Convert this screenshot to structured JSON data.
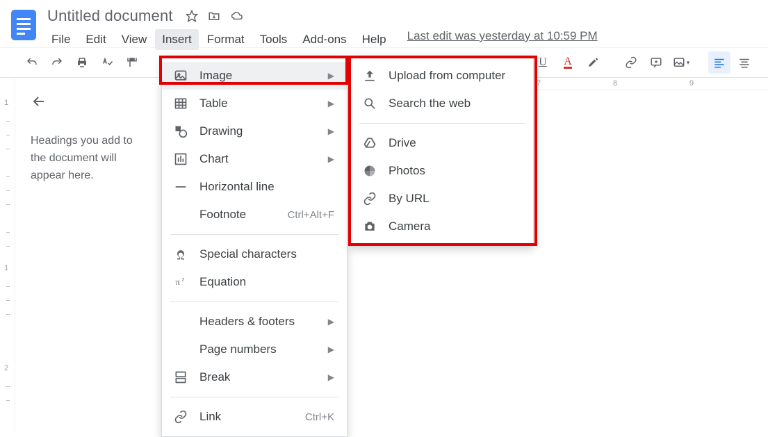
{
  "header": {
    "doc_title": "Untitled document",
    "last_edit": "Last edit was yesterday at 10:59 PM"
  },
  "menubar": [
    "File",
    "Edit",
    "View",
    "Insert",
    "Format",
    "Tools",
    "Add-ons",
    "Help"
  ],
  "active_menu_index": 3,
  "outline": {
    "hint": "Headings you add to the document will appear here."
  },
  "hruler_marks": [
    "7",
    "8",
    "9"
  ],
  "vruler_marks": [
    "1",
    "1",
    "2"
  ],
  "insert_menu": [
    {
      "icon": "image-icon",
      "label": "Image",
      "submenu": true,
      "highlight": true
    },
    {
      "icon": "table-icon",
      "label": "Table",
      "submenu": true
    },
    {
      "icon": "drawing-icon",
      "label": "Drawing",
      "submenu": true
    },
    {
      "icon": "chart-icon",
      "label": "Chart",
      "submenu": true
    },
    {
      "icon": "hr-icon",
      "label": "Horizontal line"
    },
    {
      "icon": "footnote-icon",
      "label": "Footnote",
      "shortcut": "Ctrl+Alt+F",
      "noicon": true
    },
    {
      "sep": true
    },
    {
      "icon": "omega-icon",
      "label": "Special characters"
    },
    {
      "icon": "pi-icon",
      "label": "Equation"
    },
    {
      "sep": true
    },
    {
      "icon": "header-icon",
      "label": "Headers & footers",
      "submenu": true,
      "noicon": true
    },
    {
      "icon": "pagenum-icon",
      "label": "Page numbers",
      "submenu": true,
      "noicon": true
    },
    {
      "icon": "break-icon",
      "label": "Break",
      "submenu": true
    },
    {
      "sep": true
    },
    {
      "icon": "link-icon",
      "label": "Link",
      "shortcut": "Ctrl+K"
    }
  ],
  "image_submenu": [
    {
      "icon": "upload-icon",
      "label": "Upload from computer"
    },
    {
      "icon": "search-icon",
      "label": "Search the web"
    },
    {
      "sep": true
    },
    {
      "icon": "drive-icon",
      "label": "Drive"
    },
    {
      "icon": "photos-icon",
      "label": "Photos"
    },
    {
      "icon": "url-icon",
      "label": "By URL"
    },
    {
      "icon": "camera-icon",
      "label": "Camera"
    }
  ]
}
